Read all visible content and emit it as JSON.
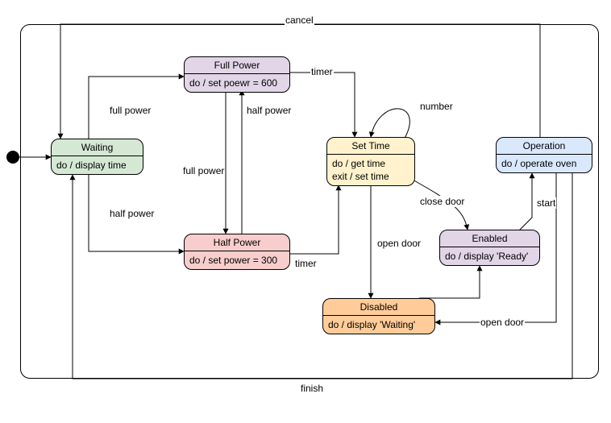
{
  "chart_data": {
    "type": "state-diagram",
    "states": [
      {
        "id": "waiting",
        "name": "Waiting",
        "action": "do / display time"
      },
      {
        "id": "full_power",
        "name": "Full Power",
        "action": "do / set poewr = 600"
      },
      {
        "id": "half_power",
        "name": "Half Power",
        "action": "do / set power = 300"
      },
      {
        "id": "set_time",
        "name": "Set Time",
        "action": "do / get time\nexit / set time"
      },
      {
        "id": "enabled",
        "name": "Enabled",
        "action": "do / display 'Ready'"
      },
      {
        "id": "disabled",
        "name": "Disabled",
        "action": "do / display 'Waiting'"
      },
      {
        "id": "operation",
        "name": "Operation",
        "action": "do / operate oven"
      }
    ],
    "transitions": [
      {
        "from": "initial",
        "to": "waiting",
        "label": ""
      },
      {
        "from": "waiting",
        "to": "full_power",
        "label": "full power"
      },
      {
        "from": "waiting",
        "to": "half_power",
        "label": "half power"
      },
      {
        "from": "full_power",
        "to": "half_power",
        "label": "half power"
      },
      {
        "from": "half_power",
        "to": "full_power",
        "label": "full power"
      },
      {
        "from": "full_power",
        "to": "set_time",
        "label": "timer"
      },
      {
        "from": "half_power",
        "to": "set_time",
        "label": "timer"
      },
      {
        "from": "set_time",
        "to": "set_time",
        "label": "number"
      },
      {
        "from": "set_time",
        "to": "disabled",
        "label": "open door"
      },
      {
        "from": "set_time",
        "to": "enabled",
        "label": "close door"
      },
      {
        "from": "disabled",
        "to": "enabled",
        "label": ""
      },
      {
        "from": "enabled",
        "to": "operation",
        "label": "start"
      },
      {
        "from": "operation",
        "to": "disabled",
        "label": "open door"
      },
      {
        "from": "operation",
        "to": "waiting",
        "label": "cancel"
      },
      {
        "from": "operation",
        "to": "waiting",
        "label": "finish"
      }
    ]
  },
  "states": {
    "waiting": {
      "title": "Waiting",
      "body": "do / display time"
    },
    "full_power": {
      "title": "Full Power",
      "body": "do / set poewr = 600"
    },
    "half_power": {
      "title": "Half Power",
      "body": "do / set power = 300"
    },
    "set_time": {
      "title": "Set Time",
      "body1": "do / get time",
      "body2": "exit / set time"
    },
    "enabled": {
      "title": "Enabled",
      "body": "do / display 'Ready'"
    },
    "disabled": {
      "title": "Disabled",
      "body": "do / display 'Waiting'"
    },
    "operation": {
      "title": "Operation",
      "body": "do / operate oven"
    }
  },
  "labels": {
    "cancel": "cancel",
    "full_power": "full power",
    "half_power": "half power",
    "half_power2": "half power",
    "full_power2": "full power",
    "timer1": "timer",
    "timer2": "timer",
    "number": "number",
    "open_door": "open door",
    "close_door": "close door",
    "start": "start",
    "open_door2": "open door",
    "finish": "finish"
  }
}
